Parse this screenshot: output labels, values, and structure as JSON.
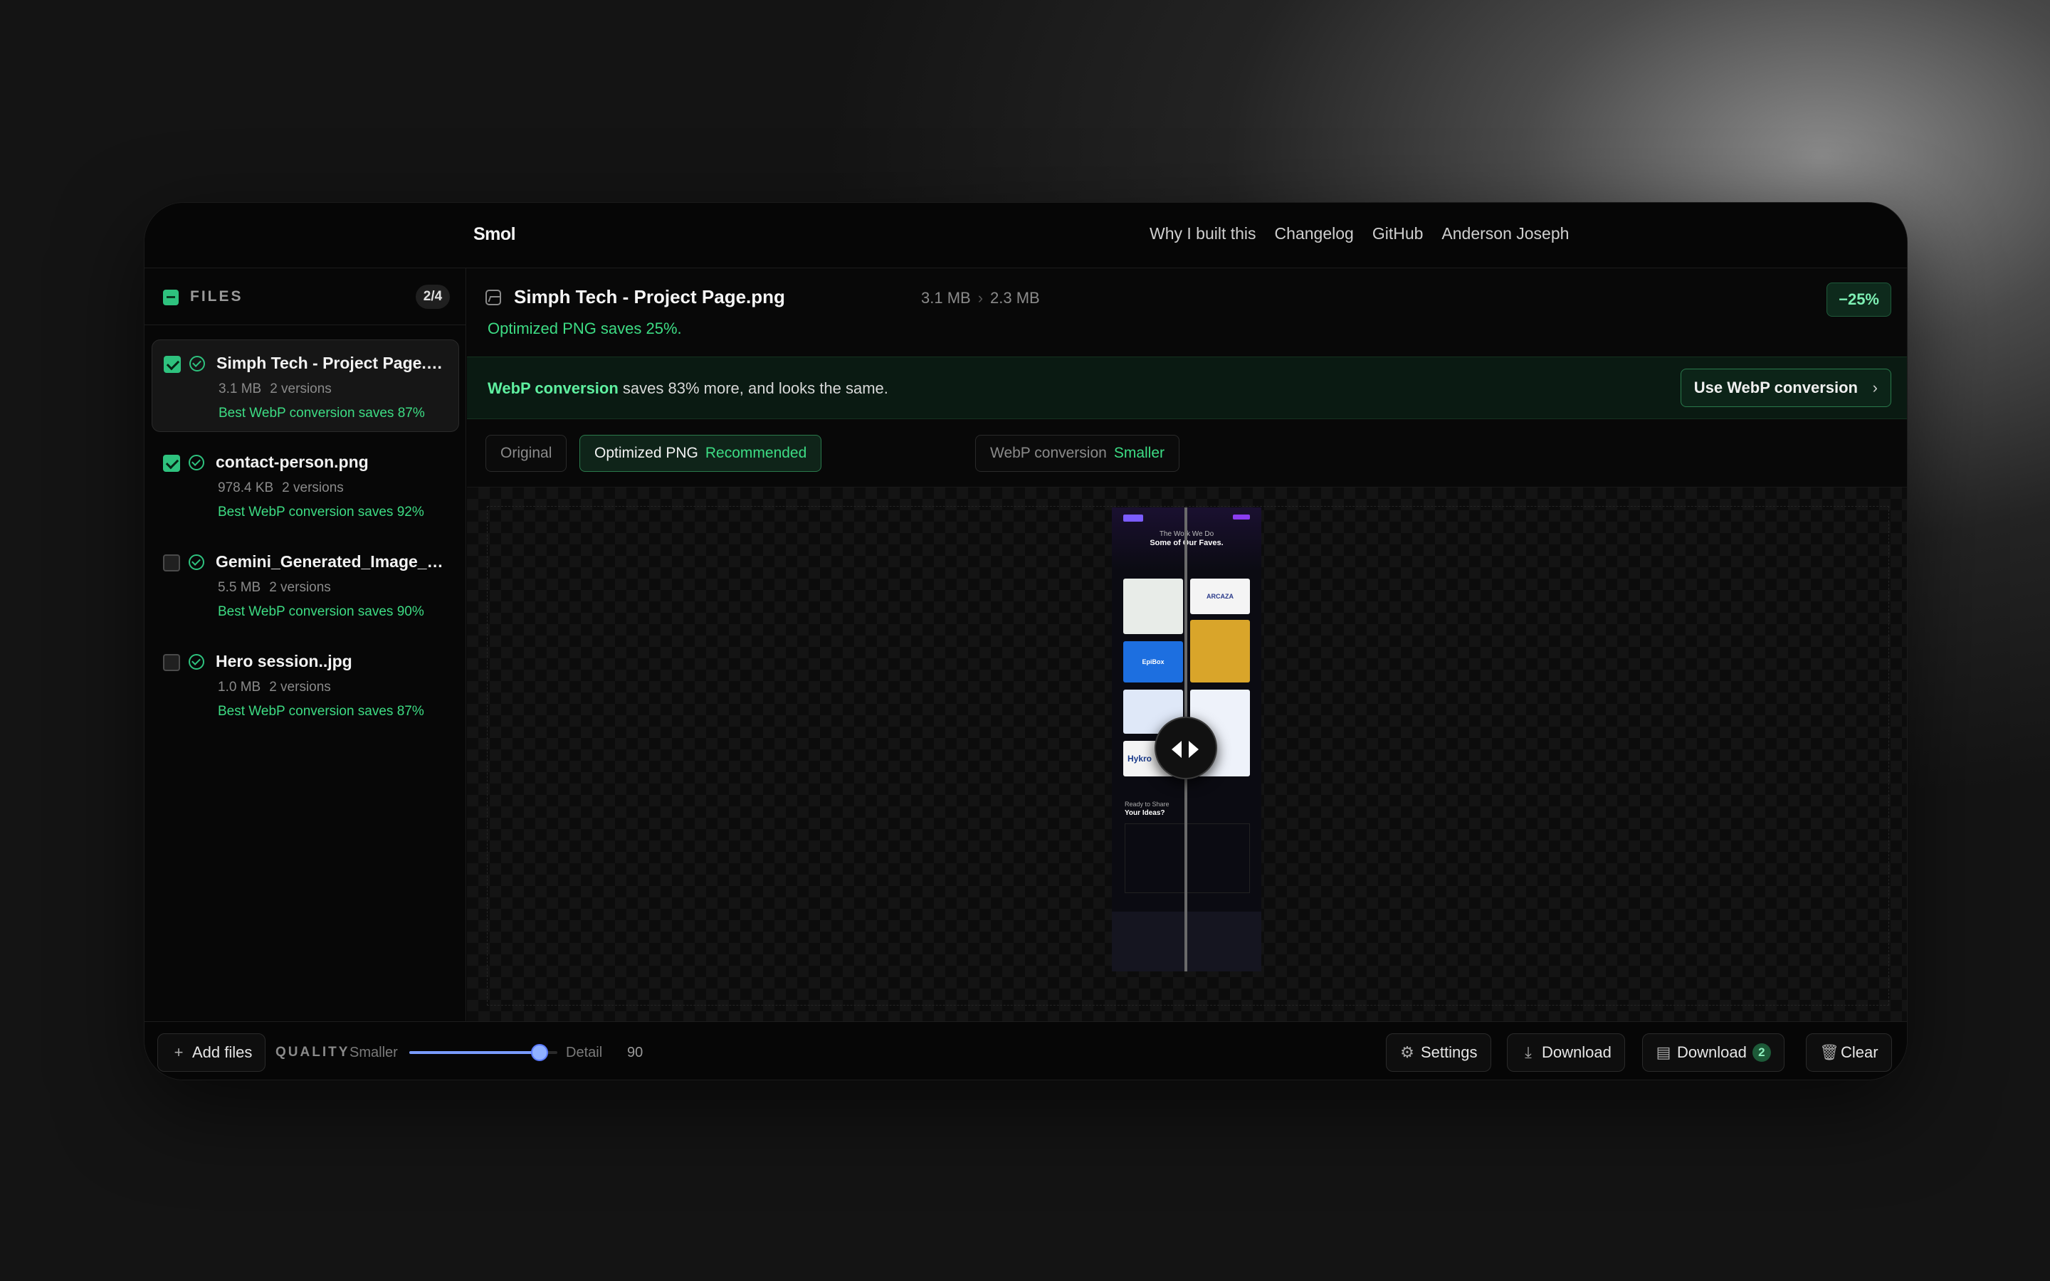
{
  "app": {
    "brand": "Smol",
    "nav": [
      "Why I built this",
      "Changelog",
      "GitHub",
      "Anderson Joseph"
    ]
  },
  "sidebar": {
    "title": "FILES",
    "count": "2/4",
    "files": [
      {
        "name": "Simph Tech - Project Page.png",
        "size": "3.1 MB",
        "versions": "2 versions",
        "saves": "Best WebP conversion saves 87%",
        "checked": true,
        "selected": true
      },
      {
        "name": "contact-person.png",
        "size": "978.4 KB",
        "versions": "2 versions",
        "saves": "Best WebP conversion saves 92%",
        "checked": true,
        "selected": false
      },
      {
        "name": "Gemini_Generated_Image_cxg...",
        "size": "5.5 MB",
        "versions": "2 versions",
        "saves": "Best WebP conversion saves 90%",
        "checked": false,
        "selected": false
      },
      {
        "name": "Hero session..jpg",
        "size": "1.0 MB",
        "versions": "2 versions",
        "saves": "Best WebP conversion saves 87%",
        "checked": false,
        "selected": false
      }
    ]
  },
  "main": {
    "file_name": "Simph Tech - Project Page.png",
    "original_size": "3.1 MB",
    "optimized_size": "2.3 MB",
    "saves_text": "Optimized PNG saves 25%.",
    "reduction_badge": "−25%",
    "promo": {
      "highlight": "WebP conversion",
      "text": " saves 83% more, and looks the same.",
      "button": "Use WebP conversion",
      "button_icon": "chevron-right-icon"
    },
    "tabs": [
      {
        "label": "Original",
        "tag": ""
      },
      {
        "label": "Optimized PNG",
        "tag": "Recommended"
      },
      {
        "label": "WebP conversion",
        "tag": "Smaller"
      }
    ],
    "active_tab": 1,
    "preview": {
      "heading_line1": "The Work We Do",
      "heading_line2": "Some of Our Faves.",
      "cta_line1": "Ready to Share",
      "cta_line2": "Your Ideas?",
      "card_labels": [
        "ARCAZA",
        "EpiBox",
        "Hykro"
      ]
    }
  },
  "bottom": {
    "add_files": "Add files",
    "quality_label": "QUALITY",
    "smaller": "Smaller",
    "detail": "Detail",
    "quality_value": "90",
    "quality_fraction": 0.88,
    "settings": "Settings",
    "download": "Download",
    "download_all": "Download",
    "download_count": "2",
    "clear": "Clear"
  },
  "colors": {
    "accent_green": "#3ddc84",
    "slider_blue": "#8fb0ff",
    "background": "#050505"
  }
}
